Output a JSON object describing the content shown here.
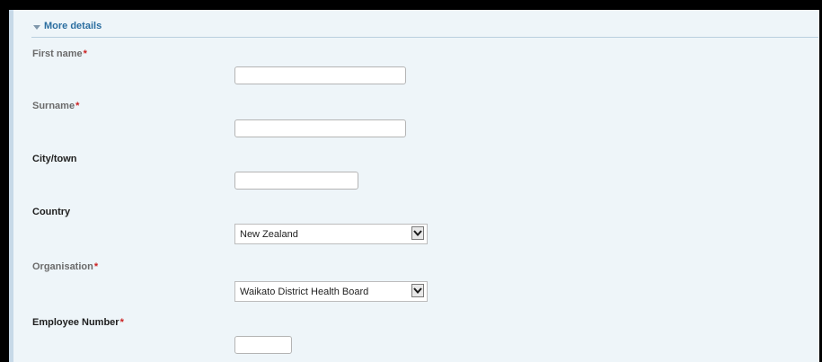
{
  "section": {
    "title": "More details",
    "icon": "triangle-down-icon"
  },
  "fields": {
    "first_name": {
      "label": "First name",
      "required_mark": "*",
      "value": ""
    },
    "surname": {
      "label": "Surname",
      "required_mark": "*",
      "value": ""
    },
    "city": {
      "label": "City/town",
      "value": ""
    },
    "country": {
      "label": "Country",
      "selected": "New Zealand"
    },
    "organisation": {
      "label": "Organisation",
      "required_mark": "*",
      "selected": "Waikato District Health Board"
    },
    "employee_number": {
      "label": "Employee Number",
      "required_mark": "*",
      "value": ""
    }
  },
  "colors": {
    "panel_background": "#eef5f9",
    "header_link": "#2b6ea0",
    "required": "#cc2222"
  }
}
